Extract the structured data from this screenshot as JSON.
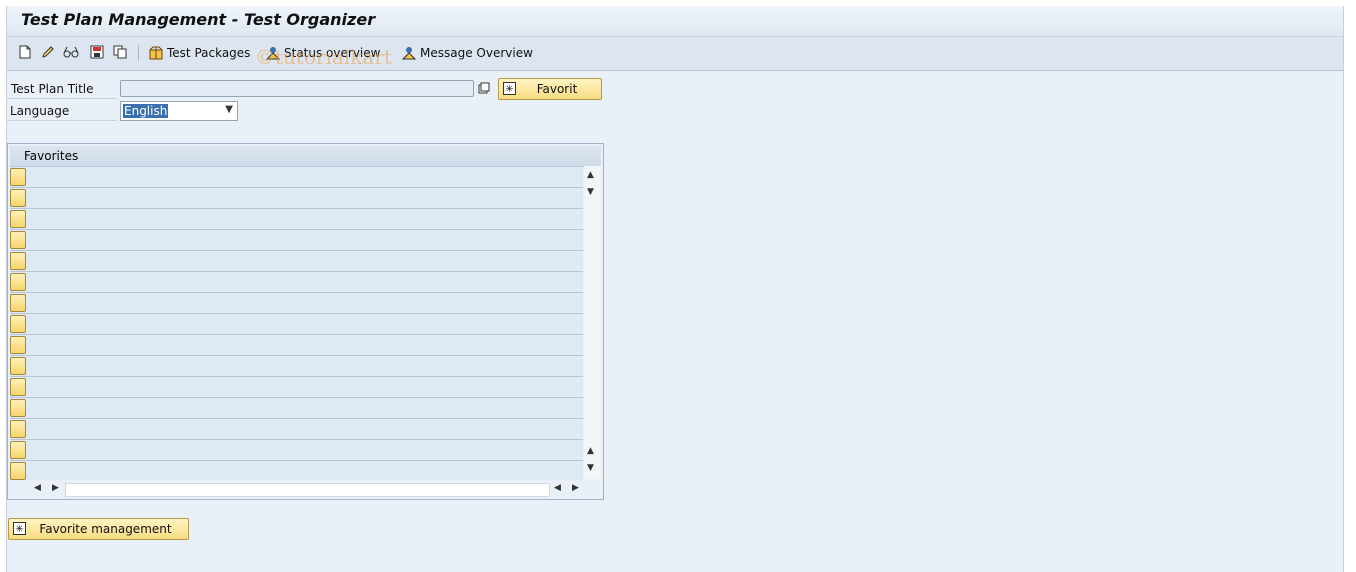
{
  "window": {
    "title": "Test Plan Management - Test Organizer"
  },
  "toolbar": {
    "icons": [
      "new-document-icon",
      "edit-pencil-icon",
      "display-glasses-icon",
      "save-icon",
      "copy-icon"
    ],
    "test_packages": "Test Packages",
    "status_overview": "Status overview",
    "message_overview": "Message Overview"
  },
  "watermark": "©tutorialkart",
  "form": {
    "test_plan_title_label": "Test Plan Title",
    "test_plan_title_value": "",
    "favorit_button": "Favorit",
    "language_label": "Language",
    "language_value": "English"
  },
  "favorites_table": {
    "header": "Favorites",
    "rows": [
      "",
      "",
      "",
      "",
      "",
      "",
      "",
      "",
      "",
      "",
      "",
      "",
      "",
      "",
      ""
    ]
  },
  "footer": {
    "favorite_management_button": "Favorite management"
  }
}
